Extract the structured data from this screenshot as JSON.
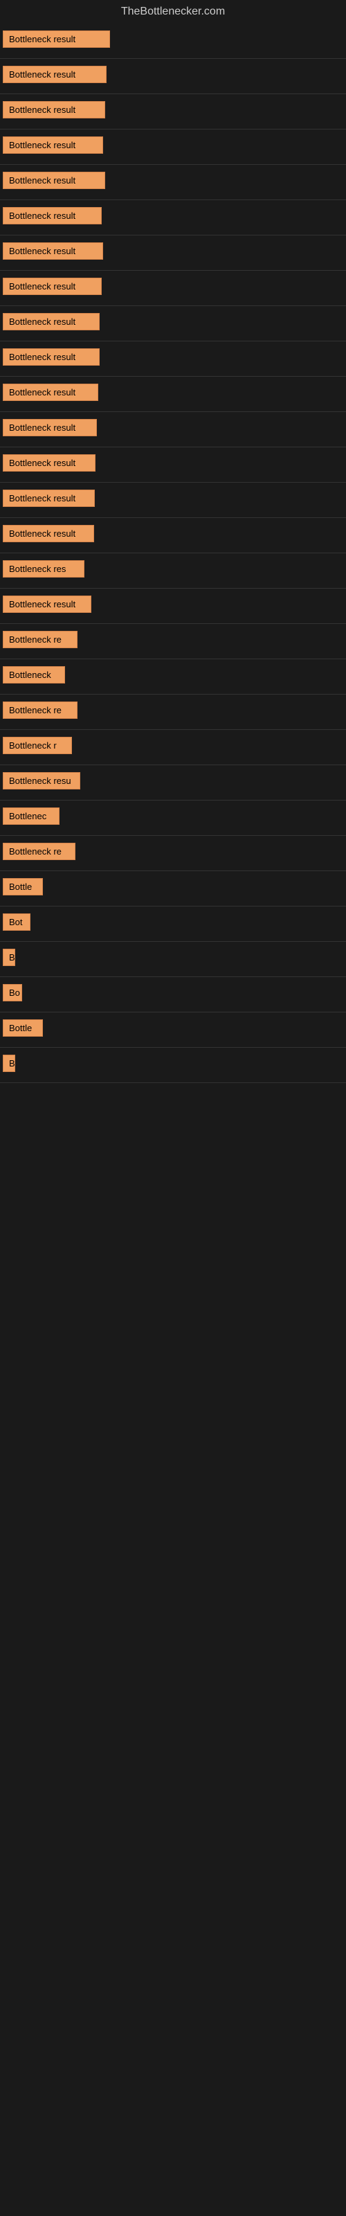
{
  "site": {
    "title": "TheBottlenecker.com"
  },
  "rows": [
    {
      "id": 1,
      "label": "Bottleneck result",
      "width": 155
    },
    {
      "id": 2,
      "label": "Bottleneck result",
      "width": 150
    },
    {
      "id": 3,
      "label": "Bottleneck result",
      "width": 148
    },
    {
      "id": 4,
      "label": "Bottleneck result",
      "width": 145
    },
    {
      "id": 5,
      "label": "Bottleneck result",
      "width": 148
    },
    {
      "id": 6,
      "label": "Bottleneck result",
      "width": 143
    },
    {
      "id": 7,
      "label": "Bottleneck result",
      "width": 145
    },
    {
      "id": 8,
      "label": "Bottleneck result",
      "width": 143
    },
    {
      "id": 9,
      "label": "Bottleneck result",
      "width": 140
    },
    {
      "id": 10,
      "label": "Bottleneck result",
      "width": 140
    },
    {
      "id": 11,
      "label": "Bottleneck result",
      "width": 138
    },
    {
      "id": 12,
      "label": "Bottleneck result",
      "width": 136
    },
    {
      "id": 13,
      "label": "Bottleneck result",
      "width": 134
    },
    {
      "id": 14,
      "label": "Bottleneck result",
      "width": 133
    },
    {
      "id": 15,
      "label": "Bottleneck result",
      "width": 132
    },
    {
      "id": 16,
      "label": "Bottleneck res",
      "width": 118
    },
    {
      "id": 17,
      "label": "Bottleneck result",
      "width": 128
    },
    {
      "id": 18,
      "label": "Bottleneck re",
      "width": 108
    },
    {
      "id": 19,
      "label": "Bottleneck",
      "width": 90
    },
    {
      "id": 20,
      "label": "Bottleneck re",
      "width": 108
    },
    {
      "id": 21,
      "label": "Bottleneck r",
      "width": 100
    },
    {
      "id": 22,
      "label": "Bottleneck resu",
      "width": 112
    },
    {
      "id": 23,
      "label": "Bottlenec",
      "width": 82
    },
    {
      "id": 24,
      "label": "Bottleneck re",
      "width": 105
    },
    {
      "id": 25,
      "label": "Bottle",
      "width": 58
    },
    {
      "id": 26,
      "label": "Bot",
      "width": 40
    },
    {
      "id": 27,
      "label": "B",
      "width": 18
    },
    {
      "id": 28,
      "label": "Bo",
      "width": 28
    },
    {
      "id": 29,
      "label": "Bottle",
      "width": 58
    },
    {
      "id": 30,
      "label": "B",
      "width": 14
    }
  ]
}
